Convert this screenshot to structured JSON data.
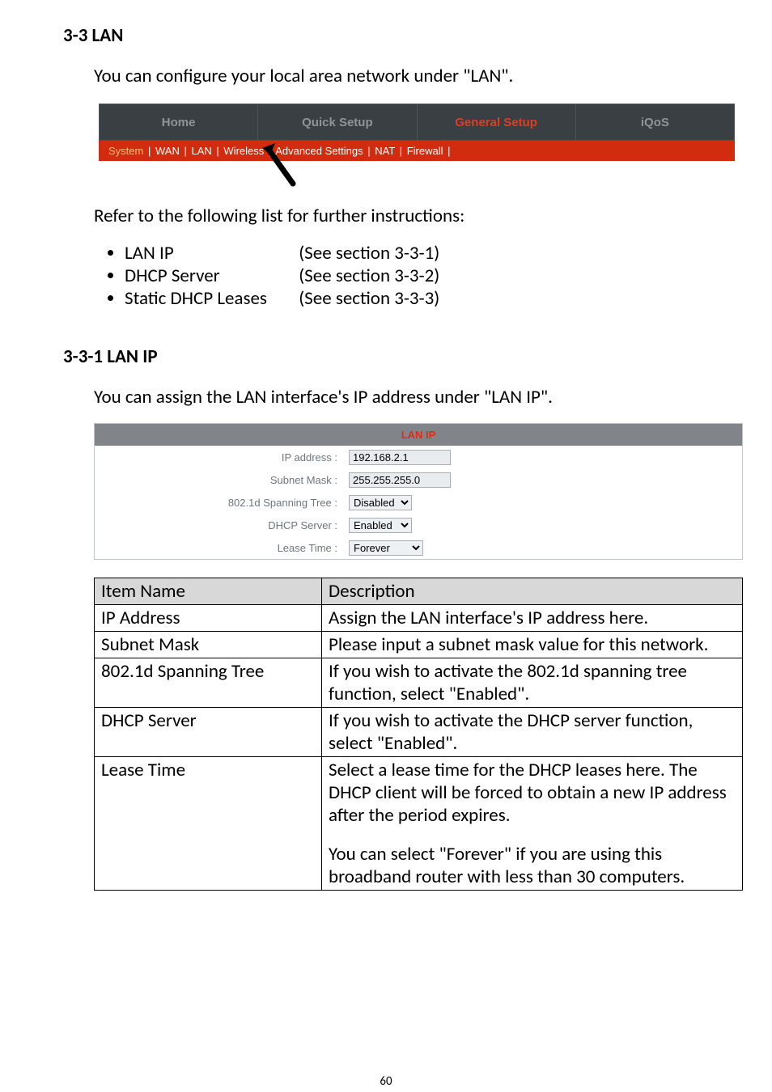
{
  "section_heading": "3-3 LAN",
  "intro_text": "You can configure your local area network under \"LAN\".",
  "refer_text": "Refer to the following list for further instructions:",
  "bullets": [
    {
      "label": "LAN IP",
      "ref": "(See section 3-3-1)"
    },
    {
      "label": "DHCP Server",
      "ref": "(See section 3-3-2)"
    },
    {
      "label": "Static DHCP Leases",
      "ref": "(See section 3-3-3)"
    }
  ],
  "subsection_heading": "3-3-1 LAN IP",
  "subsection_intro": "You can assign the LAN interface's IP address under \"LAN IP\".",
  "footer_page": "60",
  "nav": {
    "tabs": [
      {
        "label": "Home",
        "active": false
      },
      {
        "label": "Quick Setup",
        "active": false
      },
      {
        "label": "General Setup",
        "active": true
      },
      {
        "label": "iQoS",
        "active": false
      }
    ],
    "sub": {
      "system": "System",
      "items": [
        "WAN",
        "LAN",
        "Wireless",
        "Advanced Settings",
        "NAT",
        "Firewall"
      ]
    }
  },
  "lanip": {
    "title": "LAN IP",
    "rows": {
      "ip_label": "IP address :",
      "ip_value": "192.168.2.1",
      "mask_label": "Subnet Mask :",
      "mask_value": "255.255.255.0",
      "spanning_label": "802.1d Spanning Tree :",
      "spanning_value": "Disabled",
      "dhcp_label": "DHCP Server :",
      "dhcp_value": "Enabled",
      "lease_label": "Lease Time :",
      "lease_value": "Forever"
    }
  },
  "desc_table": {
    "h1": "Item Name",
    "h2": "Description",
    "rows": [
      {
        "name": "IP Address",
        "desc": "Assign the LAN interface's IP address here."
      },
      {
        "name": "Subnet Mask",
        "desc": "Please input a subnet mask value for this network."
      },
      {
        "name": "802.1d Spanning Tree",
        "desc": "If you wish to activate the 802.1d spanning tree function, select \"Enabled\"."
      },
      {
        "name": "DHCP Server",
        "desc": "If you wish to activate the DHCP server function, select \"Enabled\"."
      }
    ],
    "lease_name": "Lease Time",
    "lease_desc_1": "Select a lease time for the DHCP leases here. The DHCP client will be forced to obtain a new IP address after the period expires.",
    "lease_desc_2": "You can select \"Forever\" if you are using this broadband router with less than 30 computers."
  }
}
